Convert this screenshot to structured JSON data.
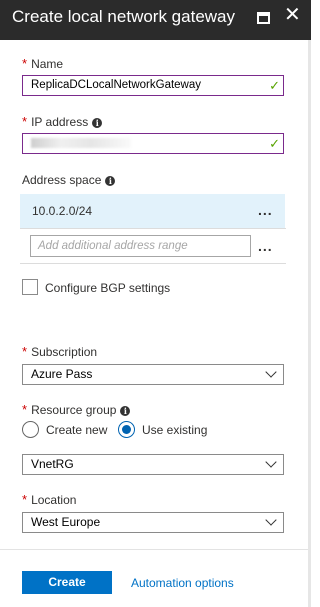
{
  "header": {
    "title": "Create local network gateway",
    "maximize_icon": "maximize-icon",
    "close_icon": "close-icon",
    "close_glyph": "✕"
  },
  "form": {
    "name": {
      "label": "Name",
      "required_mark": "*",
      "value": "ReplicaDCLocalNetworkGateway",
      "valid_mark": "✓"
    },
    "ip_address": {
      "label": "IP address",
      "required_mark": "*",
      "info_icon": "i",
      "value_obscured": true,
      "valid_mark": "✓"
    },
    "address_space": {
      "label": "Address space",
      "info_icon": "i",
      "entries": [
        "10.0.2.0/24"
      ],
      "more_glyph": "...",
      "add_placeholder": "Add additional address range"
    },
    "bgp": {
      "label": "Configure BGP settings",
      "checked": false
    },
    "subscription": {
      "label": "Subscription",
      "required_mark": "*",
      "value": "Azure Pass"
    },
    "resource_group": {
      "label": "Resource group",
      "required_mark": "*",
      "info_icon": "i",
      "option_new": "Create new",
      "option_existing": "Use existing",
      "selected_option": "Use existing",
      "value": "VnetRG"
    },
    "location": {
      "label": "Location",
      "required_mark": "*",
      "value": "West Europe"
    }
  },
  "footer": {
    "create_label": "Create",
    "automation_label": "Automation options"
  },
  "colors": {
    "header_bg": "#2b2b2b",
    "accent": "#0072c6",
    "valid_border": "#7a2a8c",
    "valid_check": "#57a300",
    "required": "#cc0000",
    "selected_row": "#e2f2fb"
  }
}
